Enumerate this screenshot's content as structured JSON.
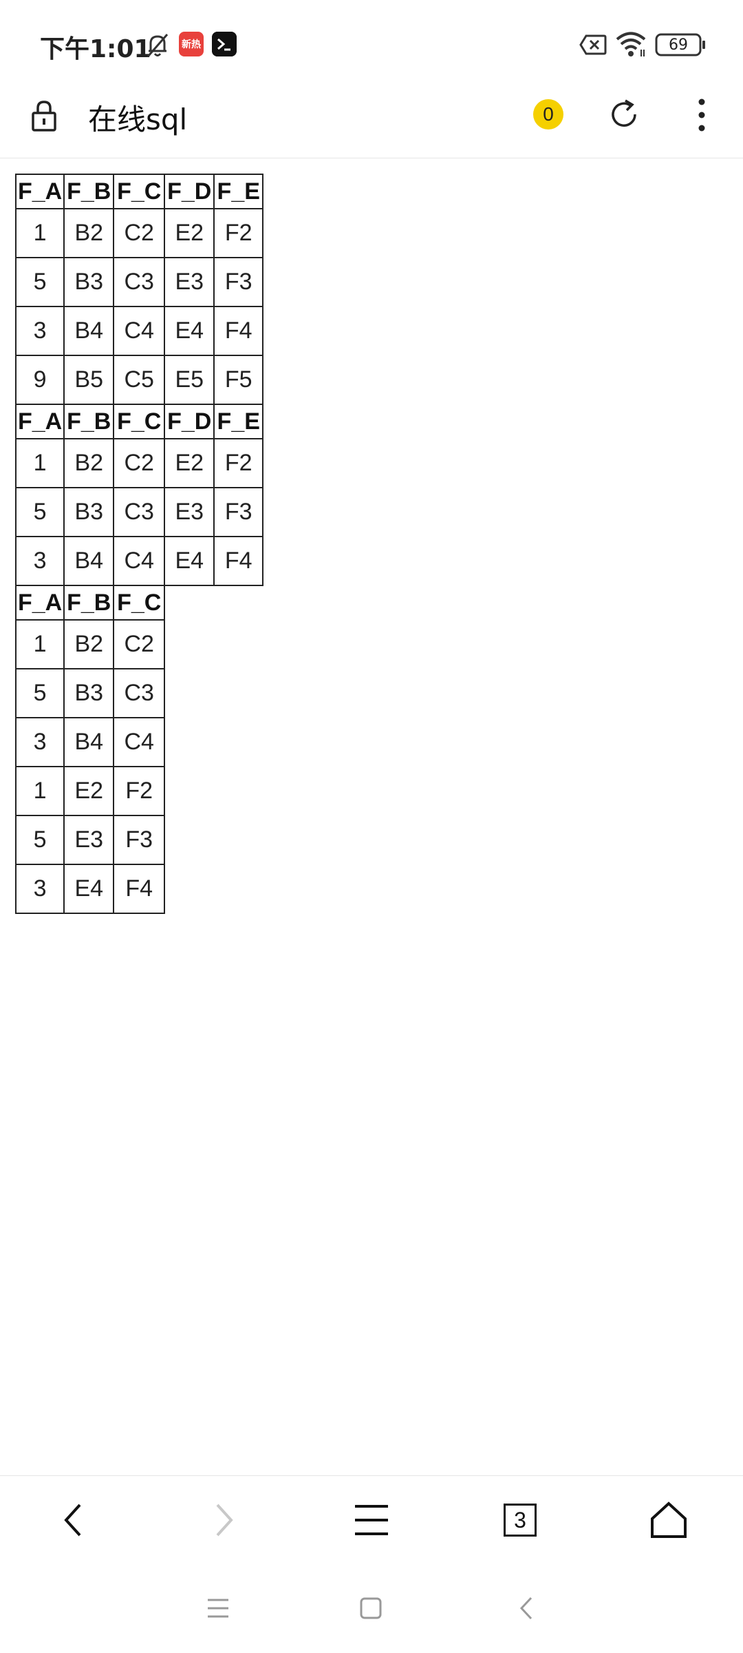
{
  "status_bar": {
    "time": "下午1:01",
    "news_app_label": "新热",
    "battery": "69"
  },
  "browser": {
    "title": "在线sql",
    "badge_count": "0",
    "tab_count": "3"
  },
  "tables": [
    {
      "headers": [
        "F_A",
        "F_B",
        "F_C",
        "F_D",
        "F_E"
      ],
      "rows": [
        [
          "1",
          "B2",
          "C2",
          "E2",
          "F2"
        ],
        [
          "5",
          "B3",
          "C3",
          "E3",
          "F3"
        ],
        [
          "3",
          "B4",
          "C4",
          "E4",
          "F4"
        ],
        [
          "9",
          "B5",
          "C5",
          "E5",
          "F5"
        ]
      ]
    },
    {
      "headers": [
        "F_A",
        "F_B",
        "F_C",
        "F_D",
        "F_E"
      ],
      "rows": [
        [
          "1",
          "B2",
          "C2",
          "E2",
          "F2"
        ],
        [
          "5",
          "B3",
          "C3",
          "E3",
          "F3"
        ],
        [
          "3",
          "B4",
          "C4",
          "E4",
          "F4"
        ]
      ]
    },
    {
      "headers": [
        "F_A",
        "F_B",
        "F_C"
      ],
      "rows": [
        [
          "1",
          "B2",
          "C2"
        ],
        [
          "5",
          "B3",
          "C3"
        ],
        [
          "3",
          "B4",
          "C4"
        ],
        [
          "1",
          "E2",
          "F2"
        ],
        [
          "5",
          "E3",
          "F3"
        ],
        [
          "3",
          "E4",
          "F4"
        ]
      ]
    }
  ],
  "colors": {
    "badge": "#f5d000",
    "news_app": "#e8413c",
    "disabled": "#c8c8c8"
  }
}
